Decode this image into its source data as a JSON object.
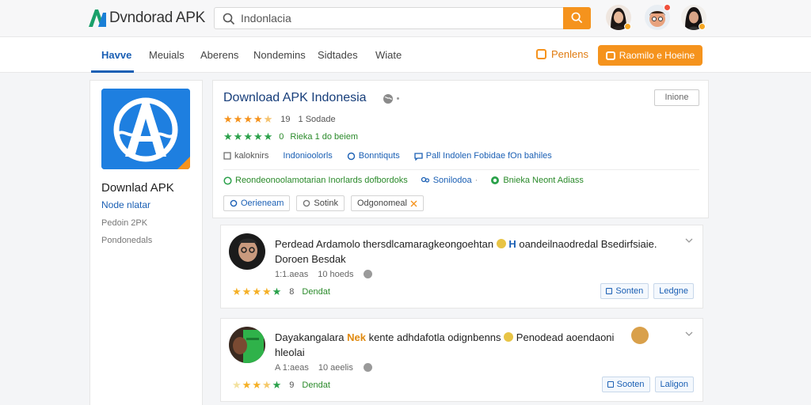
{
  "header": {
    "logo_mark": "A",
    "logo_text": "Dvndorad APK",
    "search_value": "Indonlacia",
    "colors": {
      "accent": "#f5931d",
      "brand": "#1a5fb4",
      "logo_green": "#1aa06a"
    }
  },
  "nav": {
    "items": [
      "Havve",
      "Meuials",
      "Aberens",
      "Nondemins",
      "Sidtades",
      "Wiate"
    ],
    "premium_label": "Penlens",
    "cta_label": "Raomilo e Hoeine"
  },
  "sidebar": {
    "app_name": "Downlad APK",
    "link": "Node nlatar",
    "meta1": "Pedoin 2PK",
    "meta2": "Pondonedals"
  },
  "app": {
    "title": "Download APK Indonesia",
    "top_button": "Inione",
    "rating_value": "19",
    "rating_text": "1 Sodade",
    "installs_count": "0",
    "installs_text": "Rieka 1 do beiem",
    "tags": [
      "kaloknirs",
      "Indonioolorls",
      "Bonntiquts",
      "Pall Indolen Fobidae fOn bahiles"
    ],
    "features": [
      "Reondeonoolamotarian Inorlards dofbordoks",
      "Sonilodoa",
      "Bnieka Neont Adiass"
    ],
    "chips": [
      "Oerieneam",
      "Sotink",
      "Odgonomeal"
    ]
  },
  "reviews": [
    {
      "text_line1": "Perdead Ardamolo thersdlcamaragkeongoehtan",
      "text_mid": "H",
      "text_tail": "oandeilnaodredal Bsedirfsiaie.",
      "text_line2": "Doroen Besdak",
      "date": "1:1.aeas",
      "count": "10 hoeds",
      "rating_score": "8",
      "rating_label": "Dendat",
      "btn_primary": "Sonten",
      "btn_secondary": "Ledgne",
      "stars_full": 4,
      "stars_half": 1
    },
    {
      "text_line1": "Dayakangalara",
      "text_mid": "Nek",
      "text_tail": "kente adhdafotla odignbenns",
      "text_extra": "Penodead aoendaoni",
      "text_line2": "hleolai",
      "date": "A 1:aeas",
      "count": "10 aeelis",
      "rating_score": "9",
      "rating_label": "Dendat",
      "btn_primary": "Sooten",
      "btn_secondary": "Laligon",
      "stars_full": 3,
      "stars_half": 2
    }
  ]
}
